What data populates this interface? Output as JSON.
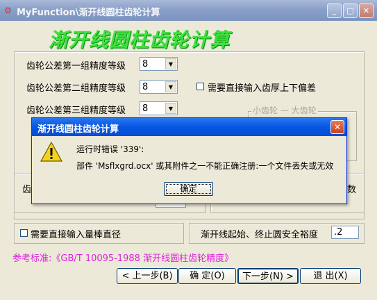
{
  "window": {
    "title": "MyFunction\\渐开线圆柱齿轮计算",
    "icon": "gear-app-icon",
    "controls": {
      "minimize": "_",
      "maximize": "□",
      "close": "✕"
    }
  },
  "banner": "渐开线圆柱齿轮计算",
  "tolerance": {
    "group1": {
      "label": "齿轮公差第一组精度等级",
      "value": "8"
    },
    "group2": {
      "label": "齿轮公差第二组精度等级",
      "value": "8"
    },
    "group3": {
      "label": "齿轮公差第三组精度等级",
      "value": "8"
    }
  },
  "checkbox_thickness": {
    "label": "需要直接输入齿厚上下偏差",
    "checked": false
  },
  "gear_group_partial": "小齿轮 — 大齿轮",
  "partial_left": "齿",
  "partial_right": "数",
  "checkbox_pin": {
    "label": "需要直接输入量棒直径",
    "checked": false
  },
  "safety_margin": {
    "label": "渐开线起始、终止圆安全裕度",
    "value": ".2"
  },
  "reference": "参考标准:《GB/T 10095-1988 渐开线圆柱齿轮精度》",
  "buttons": {
    "prev": "< 上一步(B)",
    "ok": "确  定(O)",
    "next": "下一步(N) >",
    "exit": "退  出(X)"
  },
  "dialog": {
    "title": "渐开线圆柱齿轮计算",
    "icon": "warning-icon",
    "message1": "运行时错误 '339':",
    "message2": "部件 'Msflxgrd.ocx' 或其附件之一不能正确注册:一个文件丢失或无效",
    "ok": "确定",
    "close": "✕"
  }
}
